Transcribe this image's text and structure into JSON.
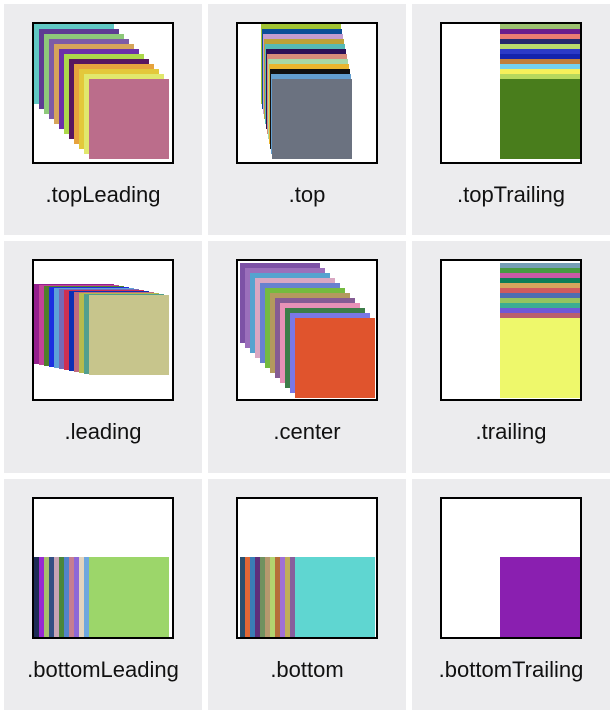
{
  "layers": 12,
  "squareSize": 80,
  "step": 5,
  "cells": [
    {
      "id": "topLeading",
      "label": ".topLeading",
      "anchor": "topLeading",
      "colors": [
        "#5fc7c3",
        "#5e3c93",
        "#8ec97a",
        "#7d5ba6",
        "#d6a55a",
        "#6c31a8",
        "#add94a",
        "#59165f",
        "#e7a33d",
        "#e3c83b",
        "#e1e86d",
        "#bb6d8b"
      ]
    },
    {
      "id": "top",
      "label": ".top",
      "anchor": "top",
      "colors": [
        "#a1c333",
        "#0c4e98",
        "#c59dd0",
        "#bda238",
        "#56bab5",
        "#2c0f57",
        "#d68b7a",
        "#a7d8a6",
        "#e9b52e",
        "#101010",
        "#639ecf",
        "#6b7280"
      ]
    },
    {
      "id": "topTrailing",
      "label": ".topTrailing",
      "anchor": "topTrailing",
      "colors": [
        "#9bc06f",
        "#6a1d8c",
        "#e97c72",
        "#242b6c",
        "#b8dc6b",
        "#2a3ac8",
        "#1223ad",
        "#c17f3a",
        "#75d0ee",
        "#f7f05a",
        "#b7d85d",
        "#497d1c"
      ]
    },
    {
      "id": "leading",
      "label": ".leading",
      "anchor": "leading",
      "colors": [
        "#941f8e",
        "#c34398",
        "#4f7f2a",
        "#1c2fe0",
        "#5ea1d8",
        "#7769b6",
        "#ce3052",
        "#0b2fb4",
        "#bf6a7e",
        "#b6bb4e",
        "#539f8e",
        "#c7c58c"
      ]
    },
    {
      "id": "center",
      "label": ".center",
      "anchor": "center",
      "colors": [
        "#7d52a6",
        "#9b6fbb",
        "#55a3cf",
        "#d9a7c2",
        "#6881cf",
        "#74bb3f",
        "#b39a5e",
        "#855c94",
        "#e891b7",
        "#3c7d49",
        "#7a78e6",
        "#e0542d"
      ]
    },
    {
      "id": "trailing",
      "label": ".trailing",
      "anchor": "trailing",
      "colors": [
        "#759fb6",
        "#479b42",
        "#c95aa6",
        "#0b7d57",
        "#d5a55c",
        "#d05a5d",
        "#4f6db1",
        "#94c460",
        "#3bad93",
        "#6e58d8",
        "#b95f6e",
        "#eef86b"
      ]
    },
    {
      "id": "bottomLeading",
      "label": ".bottomLeading",
      "anchor": "bottomLeading",
      "colors": [
        "#1d2c56",
        "#972ad1",
        "#a8be6b",
        "#334f84",
        "#c7a4b4",
        "#4a863a",
        "#5383c9",
        "#c67e8f",
        "#8d68d6",
        "#e3d4be",
        "#6fa7de",
        "#9cd66a"
      ]
    },
    {
      "id": "bottom",
      "label": ".bottom",
      "anchor": "bottom",
      "colors": [
        "#2a4f6e",
        "#e06635",
        "#3a7db6",
        "#5e2e7b",
        "#70915f",
        "#b6986f",
        "#b3d36f",
        "#b56d39",
        "#9f6fd6",
        "#bfae59",
        "#885e9c",
        "#5fd6d1"
      ]
    },
    {
      "id": "bottomTrailing",
      "label": ".bottomTrailing",
      "anchor": "bottomTrailing",
      "colors": [
        "#8a1fb0"
      ]
    }
  ]
}
